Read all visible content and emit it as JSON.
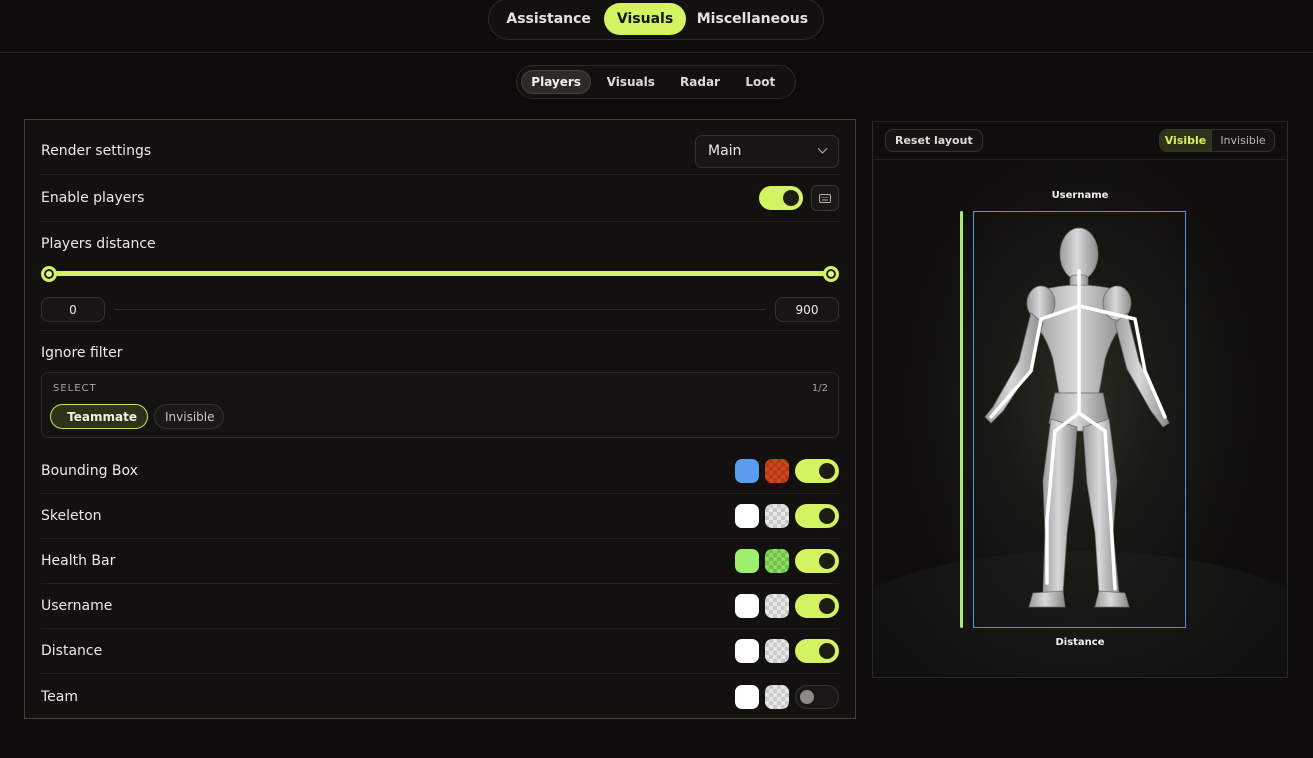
{
  "top_tabs": [
    "Assistance",
    "Visuals",
    "Miscellaneous"
  ],
  "sub_tabs": [
    "Players",
    "Visuals",
    "Radar",
    "Loot"
  ],
  "settings": {
    "render": {
      "label": "Render settings",
      "dropdown_value": "Main"
    },
    "enable_players": {
      "label": "Enable players",
      "enabled": true
    },
    "players_distance": {
      "label": "Players distance",
      "min": "0",
      "max": "900",
      "fill_fraction": 1.0
    },
    "ignore_filter": {
      "label": "Ignore filter",
      "select_label": "SELECT",
      "count": "1/2",
      "chips": [
        {
          "label": "Teammate",
          "selected": true
        },
        {
          "label": "Invisible",
          "selected": false
        }
      ]
    },
    "features": [
      {
        "label": "Bounding Box",
        "visible_color": "#5b9cf0",
        "invisible_color": "#d2451f",
        "enabled": true
      },
      {
        "label": "Skeleton",
        "visible_color": "#ffffff",
        "invisible_color": "#e7e7e7",
        "enabled": true
      },
      {
        "label": "Health Bar",
        "visible_color": "#9eef6c",
        "invisible_color": "#8ddc64",
        "enabled": true
      },
      {
        "label": "Username",
        "visible_color": "#ffffff",
        "invisible_color": "#e7e7e7",
        "enabled": true
      },
      {
        "label": "Distance",
        "visible_color": "#ffffff",
        "invisible_color": "#e7e7e7",
        "enabled": true
      },
      {
        "label": "Team",
        "visible_color": "#ffffff",
        "invisible_color": "#e7e7e7",
        "enabled": false
      }
    ]
  },
  "preview": {
    "reset_label": "Reset layout",
    "modes": [
      "Visible",
      "Invisible"
    ],
    "active_mode": "Visible",
    "username_label": "Username",
    "distance_label": "Distance"
  },
  "colors": {
    "accent": "#d3f460",
    "bbox_blue": "#5f8fe0",
    "health_green": "#a9ec6d"
  },
  "icons": {
    "keybind": "keyboard-icon",
    "dropdown": "chevron-down-icon",
    "check": "check-icon"
  }
}
